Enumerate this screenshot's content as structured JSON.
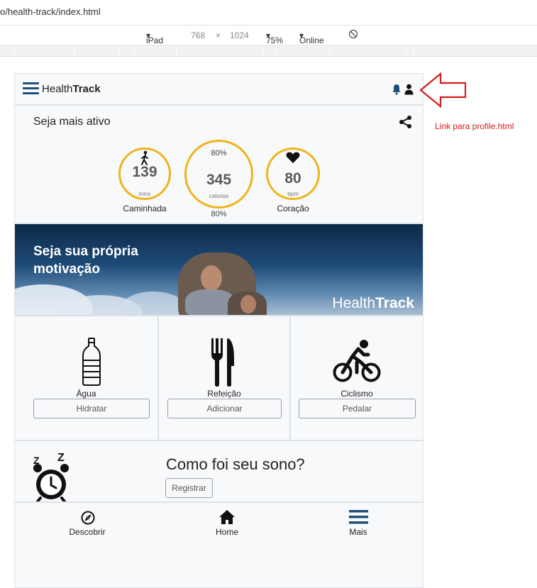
{
  "browser": {
    "url": "o/health-track/index.html",
    "device": "iPad",
    "width": "768",
    "times": "×",
    "height": "1024",
    "zoom": "75%",
    "network": "Online"
  },
  "header": {
    "brand_light": "Health",
    "brand_bold": "Track",
    "icons": [
      "hamburger-menu-icon",
      "bell-icon",
      "user-icon"
    ]
  },
  "activity": {
    "title": "Seja mais ativo",
    "share_icon": "share-icon",
    "walk": {
      "value": "139",
      "unit": "mins",
      "label": "Caminhada",
      "icon": "walking-icon"
    },
    "calories": {
      "percent_top": "80%",
      "value": "345",
      "unit": "calorias",
      "percent_bottom": "80%"
    },
    "heart": {
      "value": "80",
      "unit": "bpm",
      "label": "Coração",
      "icon": "heart-icon"
    },
    "ring_color": "#f0b41c"
  },
  "banner": {
    "text": "Seja sua própria motivação",
    "brand_light": "Health",
    "brand_bold": "Track"
  },
  "tiles": [
    {
      "icon": "water-bottle-icon",
      "label": "Água",
      "button": "Hidratar"
    },
    {
      "icon": "fork-knife-icon",
      "label": "Refeição",
      "button": "Adicionar"
    },
    {
      "icon": "bicycle-icon",
      "label": "Ciclismo",
      "button": "Pedalar"
    }
  ],
  "sleep": {
    "icon": "alarm-clock-icon",
    "zz": "Z",
    "question": "Como foi seu sono?",
    "button": "Registrar"
  },
  "bottom_nav": [
    {
      "icon": "compass-icon",
      "label": "Descobrir"
    },
    {
      "icon": "home-icon",
      "label": "Home"
    },
    {
      "icon": "hamburger-menu-icon",
      "label": "Mais"
    }
  ],
  "annotation": {
    "text": "Link para profile.html",
    "color": "#d61c1c"
  },
  "colors": {
    "accent": "#1f4e79",
    "ring": "#f0b41c",
    "annotation": "#d61c1c"
  }
}
